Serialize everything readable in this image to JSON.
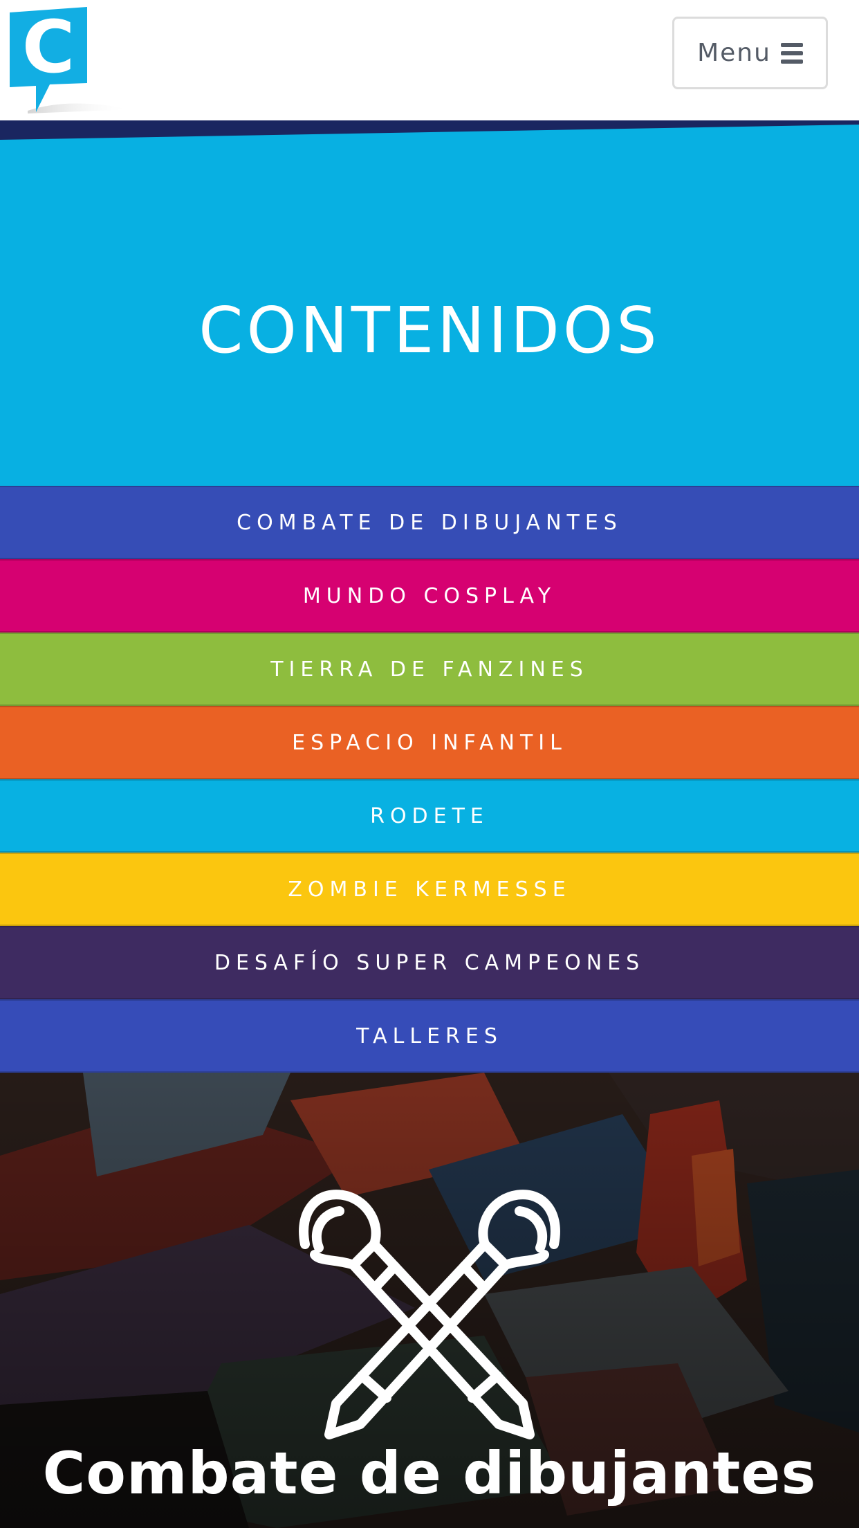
{
  "header": {
    "logo_letter": "C",
    "menu_label": "Menu",
    "menu_icon": "bars-icon",
    "brand_color": "#12aee3"
  },
  "hero": {
    "title": "CONTENIDOS",
    "background_color": "#08b0e2",
    "band_color": "#1a2660"
  },
  "categories": [
    {
      "label": "COMBATE DE DIBUJANTES",
      "color": "#364db6"
    },
    {
      "label": "MUNDO COSPLAY",
      "color": "#d60171"
    },
    {
      "label": "TIERRA DE FANZINES",
      "color": "#8ebd3e"
    },
    {
      "label": "ESPACIO INFANTIL",
      "color": "#ea6124"
    },
    {
      "label": "RODETE",
      "color": "#08b1e2"
    },
    {
      "label": "ZOMBIE KERMESSE",
      "color": "#fbc60f"
    },
    {
      "label": "DESAFÍO SUPER CAMPEONES",
      "color": "#3e2b61"
    },
    {
      "label": "TALLERES",
      "color": "#364cb8"
    }
  ],
  "feature": {
    "title": "Combate de dibujantes",
    "icon": "crossed-pencils-icon",
    "background": "comic-books-photo"
  }
}
